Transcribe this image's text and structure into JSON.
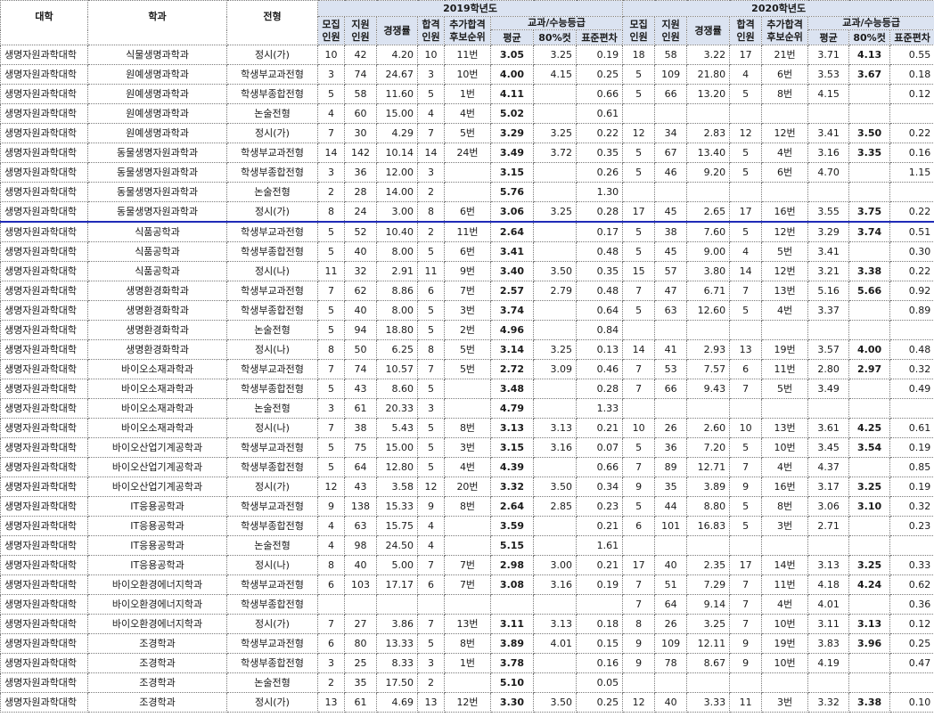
{
  "headers": {
    "univ": "대학",
    "dept": "학과",
    "type": "전형",
    "year2019": "2019학년도",
    "year2020": "2020학년도",
    "recruit": "모집\n인원",
    "apply": "지원\n인원",
    "ratio": "경쟁률",
    "pass": "합격\n인원",
    "extra": "추가합격\n후보순위",
    "grade_group": "교과/수능등급",
    "avg": "평균",
    "cut80": "80%컷",
    "std": "표준편차"
  },
  "rows": [
    [
      "생명자원과학대학",
      "식물생명과학과",
      "정시(가)",
      "10",
      "42",
      "4.20",
      "10",
      "11번",
      "3.05",
      "3.25",
      "0.19",
      "18",
      "58",
      "3.22",
      "17",
      "21번",
      "3.71",
      "4.13",
      "0.55"
    ],
    [
      "생명자원과학대학",
      "원예생명과학과",
      "학생부교과전형",
      "3",
      "74",
      "24.67",
      "3",
      "10번",
      "4.00",
      "4.15",
      "0.25",
      "5",
      "109",
      "21.80",
      "4",
      "6번",
      "3.53",
      "3.67",
      "0.18"
    ],
    [
      "생명자원과학대학",
      "원예생명과학과",
      "학생부종합전형",
      "5",
      "58",
      "11.60",
      "5",
      "1번",
      "4.11",
      "",
      "0.66",
      "5",
      "66",
      "13.20",
      "5",
      "8번",
      "4.15",
      "",
      "0.12"
    ],
    [
      "생명자원과학대학",
      "원예생명과학과",
      "논술전형",
      "4",
      "60",
      "15.00",
      "4",
      "4번",
      "5.02",
      "",
      "0.61",
      "",
      "",
      "",
      "",
      "",
      "",
      "",
      ""
    ],
    [
      "생명자원과학대학",
      "원예생명과학과",
      "정시(가)",
      "7",
      "30",
      "4.29",
      "7",
      "5번",
      "3.29",
      "3.25",
      "0.22",
      "12",
      "34",
      "2.83",
      "12",
      "12번",
      "3.41",
      "3.50",
      "0.22"
    ],
    [
      "생명자원과학대학",
      "동물생명자원과학과",
      "학생부교과전형",
      "14",
      "142",
      "10.14",
      "14",
      "24번",
      "3.49",
      "3.72",
      "0.35",
      "5",
      "67",
      "13.40",
      "5",
      "4번",
      "3.16",
      "3.35",
      "0.16"
    ],
    [
      "생명자원과학대학",
      "동물생명자원과학과",
      "학생부종합전형",
      "3",
      "36",
      "12.00",
      "3",
      "",
      "3.15",
      "",
      "0.26",
      "5",
      "46",
      "9.20",
      "5",
      "6번",
      "4.70",
      "",
      "1.15"
    ],
    [
      "생명자원과학대학",
      "동물생명자원과학과",
      "논술전형",
      "2",
      "28",
      "14.00",
      "2",
      "",
      "5.76",
      "",
      "1.30",
      "",
      "",
      "",
      "",
      "",
      "",
      "",
      ""
    ],
    [
      "생명자원과학대학",
      "동물생명자원과학과",
      "정시(가)",
      "8",
      "24",
      "3.00",
      "8",
      "6번",
      "3.06",
      "3.25",
      "0.28",
      "17",
      "45",
      "2.65",
      "17",
      "16번",
      "3.55",
      "3.75",
      "0.22"
    ],
    [
      "생명자원과학대학",
      "식품공학과",
      "학생부교과전형",
      "5",
      "52",
      "10.40",
      "2",
      "11번",
      "2.64",
      "",
      "0.17",
      "5",
      "38",
      "7.60",
      "5",
      "12번",
      "3.29",
      "3.74",
      "0.51"
    ],
    [
      "생명자원과학대학",
      "식품공학과",
      "학생부종합전형",
      "5",
      "40",
      "8.00",
      "5",
      "6번",
      "3.41",
      "",
      "0.48",
      "5",
      "45",
      "9.00",
      "4",
      "5번",
      "3.41",
      "",
      "0.30"
    ],
    [
      "생명자원과학대학",
      "식품공학과",
      "정시(나)",
      "11",
      "32",
      "2.91",
      "11",
      "9번",
      "3.40",
      "3.50",
      "0.35",
      "15",
      "57",
      "3.80",
      "14",
      "12번",
      "3.21",
      "3.38",
      "0.22"
    ],
    [
      "생명자원과학대학",
      "생명환경화학과",
      "학생부교과전형",
      "7",
      "62",
      "8.86",
      "6",
      "7번",
      "2.57",
      "2.79",
      "0.48",
      "7",
      "47",
      "6.71",
      "7",
      "13번",
      "5.16",
      "5.66",
      "0.92"
    ],
    [
      "생명자원과학대학",
      "생명환경화학과",
      "학생부종합전형",
      "5",
      "40",
      "8.00",
      "5",
      "3번",
      "3.74",
      "",
      "0.64",
      "5",
      "63",
      "12.60",
      "5",
      "4번",
      "3.37",
      "",
      "0.89"
    ],
    [
      "생명자원과학대학",
      "생명환경화학과",
      "논술전형",
      "5",
      "94",
      "18.80",
      "5",
      "2번",
      "4.96",
      "",
      "0.84",
      "",
      "",
      "",
      "",
      "",
      "",
      "",
      ""
    ],
    [
      "생명자원과학대학",
      "생명환경화학과",
      "정시(나)",
      "8",
      "50",
      "6.25",
      "8",
      "5번",
      "3.14",
      "3.25",
      "0.13",
      "14",
      "41",
      "2.93",
      "13",
      "19번",
      "3.57",
      "4.00",
      "0.48"
    ],
    [
      "생명자원과학대학",
      "바이오소재과학과",
      "학생부교과전형",
      "7",
      "74",
      "10.57",
      "7",
      "5번",
      "2.72",
      "3.09",
      "0.46",
      "7",
      "53",
      "7.57",
      "6",
      "11번",
      "2.80",
      "2.97",
      "0.32"
    ],
    [
      "생명자원과학대학",
      "바이오소재과학과",
      "학생부종합전형",
      "5",
      "43",
      "8.60",
      "5",
      "",
      "3.48",
      "",
      "0.28",
      "7",
      "66",
      "9.43",
      "7",
      "5번",
      "3.49",
      "",
      "0.49"
    ],
    [
      "생명자원과학대학",
      "바이오소재과학과",
      "논술전형",
      "3",
      "61",
      "20.33",
      "3",
      "",
      "4.79",
      "",
      "1.33",
      "",
      "",
      "",
      "",
      "",
      "",
      "",
      ""
    ],
    [
      "생명자원과학대학",
      "바이오소재과학과",
      "정시(나)",
      "7",
      "38",
      "5.43",
      "5",
      "8번",
      "3.13",
      "3.13",
      "0.21",
      "10",
      "26",
      "2.60",
      "10",
      "13번",
      "3.61",
      "4.25",
      "0.61"
    ],
    [
      "생명자원과학대학",
      "바이오산업기계공학과",
      "학생부교과전형",
      "5",
      "75",
      "15.00",
      "5",
      "3번",
      "3.15",
      "3.16",
      "0.07",
      "5",
      "36",
      "7.20",
      "5",
      "10번",
      "3.45",
      "3.54",
      "0.19"
    ],
    [
      "생명자원과학대학",
      "바이오산업기계공학과",
      "학생부종합전형",
      "5",
      "64",
      "12.80",
      "5",
      "4번",
      "4.39",
      "",
      "0.66",
      "7",
      "89",
      "12.71",
      "7",
      "4번",
      "4.37",
      "",
      "0.85"
    ],
    [
      "생명자원과학대학",
      "바이오산업기계공학과",
      "정시(가)",
      "12",
      "43",
      "3.58",
      "12",
      "20번",
      "3.32",
      "3.50",
      "0.34",
      "9",
      "35",
      "3.89",
      "9",
      "16번",
      "3.17",
      "3.25",
      "0.19"
    ],
    [
      "생명자원과학대학",
      "IT응용공학과",
      "학생부교과전형",
      "9",
      "138",
      "15.33",
      "9",
      "8번",
      "2.64",
      "2.85",
      "0.23",
      "5",
      "44",
      "8.80",
      "5",
      "8번",
      "3.06",
      "3.10",
      "0.32"
    ],
    [
      "생명자원과학대학",
      "IT응용공학과",
      "학생부종합전형",
      "4",
      "63",
      "15.75",
      "4",
      "",
      "3.59",
      "",
      "0.21",
      "6",
      "101",
      "16.83",
      "5",
      "3번",
      "2.71",
      "",
      "0.23"
    ],
    [
      "생명자원과학대학",
      "IT응용공학과",
      "논술전형",
      "4",
      "98",
      "24.50",
      "4",
      "",
      "5.15",
      "",
      "1.61",
      "",
      "",
      "",
      "",
      "",
      "",
      "",
      ""
    ],
    [
      "생명자원과학대학",
      "IT응용공학과",
      "정시(나)",
      "8",
      "40",
      "5.00",
      "7",
      "7번",
      "2.98",
      "3.00",
      "0.21",
      "17",
      "40",
      "2.35",
      "17",
      "14번",
      "3.13",
      "3.25",
      "0.33"
    ],
    [
      "생명자원과학대학",
      "바이오환경에너지학과",
      "학생부교과전형",
      "6",
      "103",
      "17.17",
      "6",
      "7번",
      "3.08",
      "3.16",
      "0.19",
      "7",
      "51",
      "7.29",
      "7",
      "11번",
      "4.18",
      "4.24",
      "0.62"
    ],
    [
      "생명자원과학대학",
      "바이오환경에너지학과",
      "학생부종합전형",
      "",
      "",
      "",
      "",
      "",
      "",
      "",
      "",
      "7",
      "64",
      "9.14",
      "7",
      "4번",
      "4.01",
      "",
      "0.36"
    ],
    [
      "생명자원과학대학",
      "바이오환경에너지학과",
      "정시(가)",
      "7",
      "27",
      "3.86",
      "7",
      "13번",
      "3.11",
      "3.13",
      "0.18",
      "8",
      "26",
      "3.25",
      "7",
      "10번",
      "3.11",
      "3.13",
      "0.12"
    ],
    [
      "생명자원과학대학",
      "조경학과",
      "학생부교과전형",
      "6",
      "80",
      "13.33",
      "5",
      "8번",
      "3.89",
      "4.01",
      "0.15",
      "9",
      "109",
      "12.11",
      "9",
      "19번",
      "3.83",
      "3.96",
      "0.25"
    ],
    [
      "생명자원과학대학",
      "조경학과",
      "학생부종합전형",
      "3",
      "25",
      "8.33",
      "3",
      "1번",
      "3.78",
      "",
      "0.16",
      "9",
      "78",
      "8.67",
      "9",
      "10번",
      "4.19",
      "",
      "0.47"
    ],
    [
      "생명자원과학대학",
      "조경학과",
      "논술전형",
      "2",
      "35",
      "17.50",
      "2",
      "",
      "5.10",
      "",
      "0.05",
      "",
      "",
      "",
      "",
      "",
      "",
      "",
      ""
    ],
    [
      "생명자원과학대학",
      "조경학과",
      "정시(가)",
      "13",
      "61",
      "4.69",
      "13",
      "12번",
      "3.30",
      "3.50",
      "0.25",
      "12",
      "40",
      "3.33",
      "11",
      "3번",
      "3.32",
      "3.38",
      "0.10"
    ]
  ]
}
